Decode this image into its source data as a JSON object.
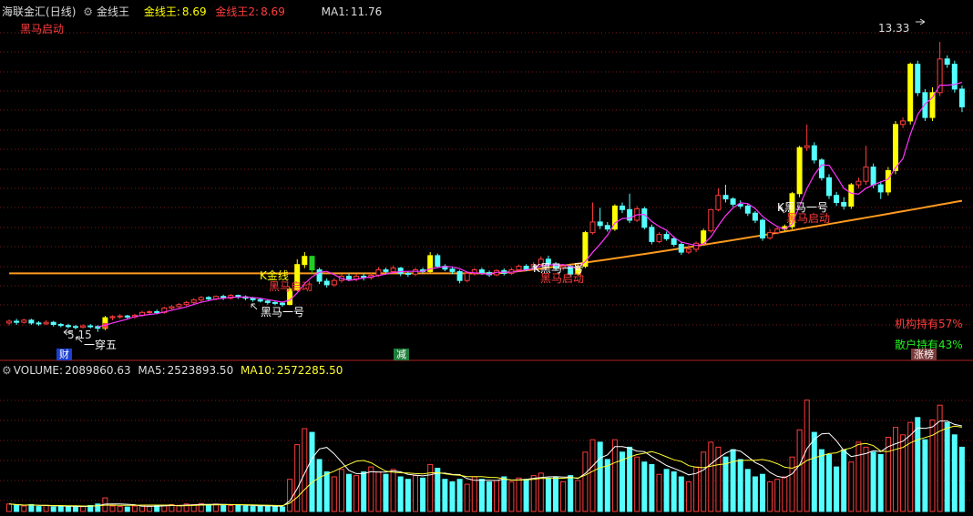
{
  "header": {
    "app_name": "海联金汇",
    "period": "(日线)",
    "indicator_name": "金线王",
    "line1_label": "金线王:",
    "line1_value": "8.69",
    "line2_label": "金线王2:",
    "line2_value": "8.69",
    "ma_label": "MA1:",
    "ma_value": "11.76"
  },
  "annotations": {
    "heima_start_top": "黑马启动",
    "price_high": "13.33",
    "price_low": "5.15",
    "yi_chuan_wu": "一穿五",
    "heima_yihao": "黑马一号",
    "k_jinxian": "K金线",
    "heima_qidong": "黑马启动",
    "k_heima_yihao": "K黑马一号",
    "jigou": "机构持有57%",
    "sanhu": "散户持有43%"
  },
  "badges": {
    "cai": "财",
    "jian": "减",
    "zhangbang": "涨榜"
  },
  "volume": {
    "label": "VOLUME:",
    "value": "2089860.63",
    "ma5_label": "MA5:",
    "ma5_value": "2523893.50",
    "ma10_label": "MA10:",
    "ma10_value": "2572285.50"
  },
  "colors": {
    "up": "#ff3c3c",
    "down": "#54ffff",
    "signal_yellow": "#ffff00",
    "signal_green": "#22cc22",
    "ma_magenta": "#ff33ff",
    "gold_line": "#ff9a1f",
    "vol_ma5": "#ffffff",
    "vol_ma10": "#ffff33"
  },
  "chart_data": {
    "type": "candlestick",
    "price_ylim": [
      4.5,
      14.0
    ],
    "volume_ylim": [
      0,
      5300000
    ],
    "candles": [
      [
        5.4,
        5.45,
        5.33,
        5.5,
        0
      ],
      [
        5.45,
        5.42,
        5.35,
        5.52,
        0
      ],
      [
        5.42,
        5.48,
        5.38,
        5.52,
        0
      ],
      [
        5.48,
        5.4,
        5.35,
        5.52,
        0
      ],
      [
        5.4,
        5.38,
        5.32,
        5.45,
        0
      ],
      [
        5.38,
        5.42,
        5.34,
        5.48,
        0
      ],
      [
        5.42,
        5.36,
        5.3,
        5.46,
        0
      ],
      [
        5.36,
        5.33,
        5.28,
        5.4,
        0
      ],
      [
        5.33,
        5.3,
        5.25,
        5.38,
        0
      ],
      [
        5.3,
        5.28,
        5.22,
        5.35,
        0
      ],
      [
        5.28,
        5.32,
        5.25,
        5.36,
        0
      ],
      [
        5.32,
        5.3,
        5.25,
        5.37,
        0
      ],
      [
        5.3,
        5.25,
        5.15,
        5.34,
        0
      ],
      [
        5.25,
        5.55,
        5.2,
        5.6,
        2
      ],
      [
        5.55,
        5.58,
        5.48,
        5.62,
        0
      ],
      [
        5.58,
        5.6,
        5.52,
        5.65,
        0
      ],
      [
        5.6,
        5.57,
        5.5,
        5.63,
        0
      ],
      [
        5.57,
        5.62,
        5.52,
        5.66,
        0
      ],
      [
        5.62,
        5.7,
        5.58,
        5.74,
        0
      ],
      [
        5.7,
        5.72,
        5.64,
        5.76,
        0
      ],
      [
        5.72,
        5.7,
        5.65,
        5.78,
        0
      ],
      [
        5.7,
        5.82,
        5.66,
        5.86,
        0
      ],
      [
        5.82,
        5.86,
        5.78,
        5.9,
        0
      ],
      [
        5.86,
        5.92,
        5.82,
        5.96,
        0
      ],
      [
        5.92,
        5.98,
        5.88,
        6.02,
        0
      ],
      [
        5.98,
        6.05,
        5.93,
        6.1,
        0
      ],
      [
        6.05,
        6.12,
        6.0,
        6.16,
        0
      ],
      [
        6.12,
        6.08,
        6.02,
        6.16,
        0
      ],
      [
        6.08,
        6.15,
        6.04,
        6.18,
        0
      ],
      [
        6.15,
        6.1,
        6.05,
        6.2,
        0
      ],
      [
        6.1,
        6.18,
        6.06,
        6.22,
        0
      ],
      [
        6.18,
        6.14,
        6.08,
        6.2,
        0
      ],
      [
        6.14,
        6.1,
        6.04,
        6.18,
        0
      ],
      [
        6.1,
        6.06,
        6.0,
        6.14,
        0
      ],
      [
        6.06,
        6.02,
        5.98,
        6.1,
        0
      ],
      [
        6.02,
        5.98,
        5.92,
        6.06,
        0
      ],
      [
        5.98,
        5.96,
        5.9,
        6.02,
        0
      ],
      [
        5.96,
        5.92,
        5.86,
        6.0,
        0
      ],
      [
        5.92,
        6.35,
        5.9,
        6.4,
        1
      ],
      [
        6.35,
        7.05,
        6.3,
        7.2,
        1
      ],
      [
        7.05,
        7.28,
        6.95,
        7.4,
        1
      ],
      [
        7.28,
        6.9,
        6.8,
        7.3,
        3
      ],
      [
        6.9,
        6.58,
        6.5,
        6.96,
        0
      ],
      [
        6.58,
        6.48,
        6.4,
        6.66,
        0
      ],
      [
        6.48,
        6.6,
        6.42,
        6.66,
        0
      ],
      [
        6.6,
        6.72,
        6.54,
        6.78,
        0
      ],
      [
        6.72,
        6.64,
        6.58,
        6.8,
        0
      ],
      [
        6.64,
        6.72,
        6.58,
        6.78,
        0
      ],
      [
        6.72,
        6.68,
        6.6,
        6.8,
        0
      ],
      [
        6.68,
        6.75,
        6.62,
        6.82,
        0
      ],
      [
        6.75,
        6.9,
        6.7,
        6.98,
        0
      ],
      [
        6.9,
        6.85,
        6.78,
        6.96,
        0
      ],
      [
        6.85,
        6.95,
        6.8,
        7.02,
        0
      ],
      [
        6.95,
        6.8,
        6.72,
        6.98,
        0
      ],
      [
        6.8,
        6.78,
        6.7,
        6.86,
        0
      ],
      [
        6.78,
        6.9,
        6.72,
        6.96,
        0
      ],
      [
        6.9,
        6.85,
        6.8,
        6.96,
        0
      ],
      [
        6.85,
        7.3,
        6.82,
        7.4,
        1
      ],
      [
        7.3,
        7.0,
        6.96,
        7.36,
        0
      ],
      [
        7.0,
        6.92,
        6.86,
        7.06,
        0
      ],
      [
        6.92,
        6.85,
        6.78,
        6.98,
        0
      ],
      [
        6.85,
        6.6,
        6.52,
        6.9,
        0
      ],
      [
        6.6,
        6.8,
        6.55,
        6.86,
        0
      ],
      [
        6.8,
        6.9,
        6.74,
        6.95,
        0
      ],
      [
        6.9,
        6.82,
        6.76,
        6.96,
        0
      ],
      [
        6.82,
        6.76,
        6.7,
        6.88,
        0
      ],
      [
        6.76,
        6.88,
        6.72,
        6.92,
        0
      ],
      [
        6.88,
        6.8,
        6.74,
        6.94,
        0
      ],
      [
        6.8,
        6.9,
        6.76,
        6.96,
        0
      ],
      [
        6.9,
        7.0,
        6.86,
        7.05,
        0
      ],
      [
        7.0,
        6.92,
        6.86,
        7.06,
        0
      ],
      [
        6.92,
        7.05,
        6.88,
        7.12,
        0
      ],
      [
        7.05,
        7.2,
        7.0,
        7.28,
        0
      ],
      [
        7.2,
        7.05,
        7.0,
        7.3,
        0
      ],
      [
        7.05,
        6.95,
        6.88,
        7.12,
        0
      ],
      [
        6.95,
        7.0,
        6.88,
        7.06,
        0
      ],
      [
        7.0,
        6.78,
        6.72,
        7.04,
        0
      ],
      [
        6.78,
        7.0,
        6.74,
        7.05,
        1
      ],
      [
        7.0,
        7.95,
        6.95,
        8.0,
        1
      ],
      [
        7.95,
        8.25,
        7.9,
        8.8,
        0
      ],
      [
        8.25,
        8.15,
        8.05,
        8.65,
        0
      ],
      [
        8.15,
        8.05,
        7.98,
        8.25,
        0
      ],
      [
        8.05,
        8.7,
        8.0,
        8.75,
        1
      ],
      [
        8.7,
        8.6,
        8.5,
        8.8,
        0
      ],
      [
        8.6,
        8.3,
        8.22,
        9.05,
        0
      ],
      [
        8.3,
        8.62,
        8.25,
        8.7,
        0
      ],
      [
        8.62,
        8.1,
        8.04,
        8.68,
        0
      ],
      [
        8.1,
        7.7,
        7.62,
        8.18,
        0
      ],
      [
        7.7,
        7.9,
        7.65,
        7.96,
        0
      ],
      [
        7.9,
        7.78,
        7.72,
        7.98,
        0
      ],
      [
        7.78,
        7.62,
        7.55,
        7.85,
        0
      ],
      [
        7.62,
        7.4,
        7.32,
        7.68,
        0
      ],
      [
        7.4,
        7.48,
        7.35,
        7.6,
        0
      ],
      [
        7.48,
        7.65,
        7.4,
        7.7,
        0
      ],
      [
        7.65,
        8.0,
        7.6,
        8.06,
        1
      ],
      [
        8.0,
        8.6,
        7.95,
        8.62,
        0
      ],
      [
        8.6,
        9.0,
        8.55,
        9.2,
        0
      ],
      [
        9.0,
        8.9,
        8.8,
        9.3,
        0
      ],
      [
        8.9,
        8.75,
        8.68,
        8.95,
        0
      ],
      [
        8.75,
        8.7,
        8.62,
        8.86,
        0
      ],
      [
        8.7,
        8.5,
        8.42,
        8.76,
        0
      ],
      [
        8.5,
        8.3,
        8.22,
        8.56,
        0
      ],
      [
        8.3,
        7.8,
        7.72,
        8.35,
        0
      ],
      [
        7.8,
        7.95,
        7.75,
        8.05,
        0
      ],
      [
        7.95,
        8.05,
        7.9,
        8.1,
        0
      ],
      [
        8.05,
        8.12,
        7.98,
        8.18,
        1
      ],
      [
        8.12,
        9.05,
        8.05,
        9.1,
        1
      ],
      [
        9.05,
        10.35,
        8.95,
        10.4,
        1
      ],
      [
        10.35,
        10.4,
        10.25,
        11.0,
        0
      ],
      [
        10.4,
        10.0,
        9.9,
        10.5,
        0
      ],
      [
        10.0,
        9.5,
        9.42,
        10.05,
        0
      ],
      [
        9.5,
        9.0,
        8.9,
        9.6,
        0
      ],
      [
        9.0,
        8.8,
        8.7,
        9.1,
        0
      ],
      [
        8.8,
        8.7,
        8.6,
        8.95,
        0
      ],
      [
        8.7,
        9.3,
        8.62,
        9.35,
        1
      ],
      [
        9.3,
        9.4,
        9.2,
        9.5,
        0
      ],
      [
        9.4,
        9.8,
        9.3,
        10.4,
        0
      ],
      [
        9.8,
        9.3,
        9.2,
        9.9,
        0
      ],
      [
        9.3,
        9.1,
        8.9,
        9.4,
        0
      ],
      [
        9.1,
        9.7,
        9.0,
        9.8,
        1
      ],
      [
        9.7,
        11.0,
        9.6,
        11.1,
        1
      ],
      [
        11.0,
        11.1,
        10.9,
        11.2,
        0
      ],
      [
        11.1,
        12.7,
        11.0,
        12.75,
        1
      ],
      [
        12.7,
        11.9,
        11.8,
        12.8,
        0
      ],
      [
        11.9,
        11.2,
        11.1,
        12.0,
        0
      ],
      [
        11.2,
        11.9,
        11.1,
        12.05,
        1
      ],
      [
        11.9,
        12.85,
        11.8,
        13.33,
        0
      ],
      [
        12.85,
        12.7,
        12.6,
        12.95,
        0
      ],
      [
        12.7,
        12.0,
        11.9,
        12.8,
        0
      ],
      [
        12.0,
        11.5,
        11.35,
        12.1,
        0
      ]
    ],
    "ma_line": [],
    "gold_line_left": 6.8,
    "gold_line_right": 8.85,
    "volume": [
      0.3,
      0.25,
      0.22,
      0.28,
      0.2,
      0.25,
      0.18,
      0.22,
      0.2,
      0.18,
      0.22,
      0.24,
      0.3,
      0.55,
      0.22,
      0.2,
      0.18,
      0.22,
      0.25,
      0.2,
      0.22,
      0.24,
      0.28,
      0.25,
      0.3,
      0.28,
      0.32,
      0.26,
      0.3,
      0.28,
      0.24,
      0.26,
      0.22,
      0.2,
      0.22,
      0.24,
      0.2,
      0.18,
      1.3,
      2.7,
      3.35,
      3.2,
      2.1,
      1.6,
      1.4,
      1.7,
      1.5,
      1.45,
      1.6,
      1.8,
      1.6,
      1.5,
      1.7,
      1.4,
      1.3,
      1.45,
      1.35,
      1.9,
      1.75,
      1.3,
      1.2,
      1.3,
      1.1,
      1.4,
      1.3,
      1.2,
      1.25,
      1.4,
      1.2,
      1.35,
      1.3,
      1.45,
      1.55,
      1.35,
      1.4,
      1.2,
      1.45,
      1.25,
      2.4,
      2.9,
      2.8,
      2.1,
      2.9,
      2.4,
      2.6,
      2.2,
      2.0,
      1.9,
      1.5,
      1.7,
      1.6,
      1.4,
      1.2,
      1.8,
      2.4,
      2.8,
      2.6,
      2.2,
      2.5,
      2.1,
      1.7,
      1.4,
      1.5,
      1.2,
      1.3,
      1.4,
      2.2,
      3.3,
      4.5,
      3.2,
      2.5,
      2.3,
      1.8,
      2.5,
      2.0,
      2.8,
      2.6,
      2.4,
      2.3,
      3.0,
      3.4,
      3.1,
      3.6,
      3.8,
      2.9,
      3.7,
      4.3,
      3.6,
      3.1,
      2.6
    ]
  }
}
